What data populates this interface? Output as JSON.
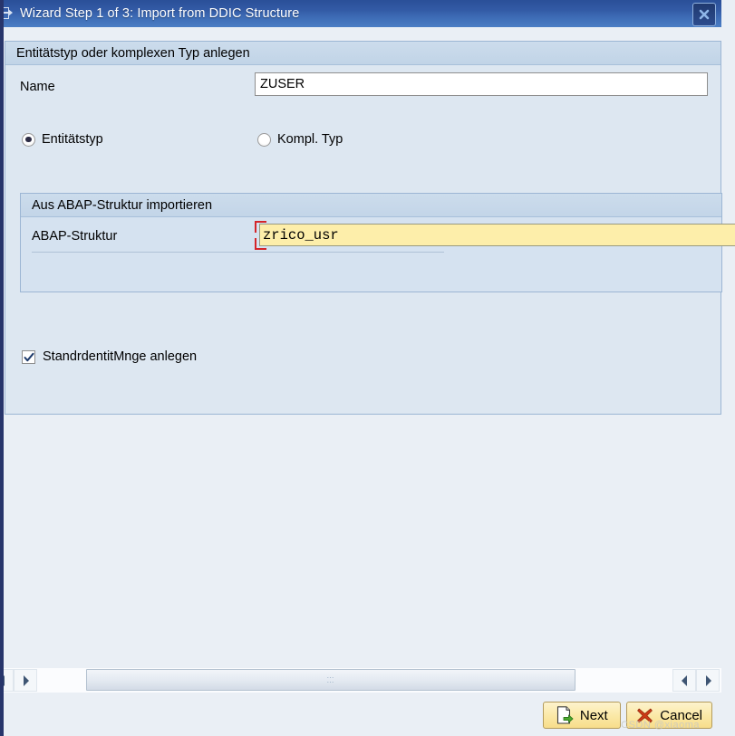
{
  "window": {
    "title": "Wizard Step 1 of 3: Import from DDIC Structure",
    "title_icon": "wizard-window-icon",
    "close_icon": "close-icon",
    "accent_color": "#335ba6",
    "panel_color": "#d8e3ef",
    "focus_color": "#d4252a",
    "field_focus_color": "#fdeeaa"
  },
  "outer_panel": {
    "header": "Entitätstyp oder komplexen Typ anlegen",
    "name_label": "Name",
    "name_value": "ZUSER",
    "name_placeholder": ""
  },
  "type_options": [
    {
      "label": "Entitätstyp",
      "selected": true
    },
    {
      "label": "Kompl. Typ",
      "selected": false
    }
  ],
  "inner_panel": {
    "header": "Aus ABAP-Struktur importieren",
    "abap_label": "ABAP-Struktur",
    "abap_value": "zrico_usr",
    "abap_placeholder": ""
  },
  "checkbox": {
    "label": "StandrdentitMnge anlegen",
    "checked": true
  },
  "scrollbar": {
    "left_arrow_icon": "arrow-left-icon",
    "right_arrow_icon": "arrow-right-icon",
    "grip": "⋯"
  },
  "buttons": [
    {
      "label": "Next",
      "icon": "document-next-icon"
    },
    {
      "label": "Cancel",
      "icon": "red-x-icon"
    }
  ],
  "watermark": "CSDN @xiaoma"
}
